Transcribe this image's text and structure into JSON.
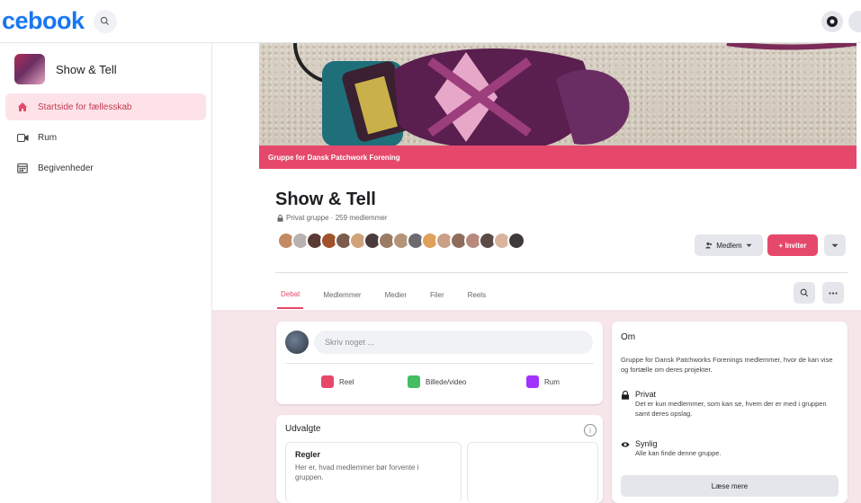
{
  "topbar": {
    "logo": "cebook"
  },
  "sidebar": {
    "group_name": "Show & Tell",
    "items": [
      {
        "label": "Startside for fællesskab",
        "icon": "home-icon"
      },
      {
        "label": "Rum",
        "icon": "video-icon"
      },
      {
        "label": "Begivenheder",
        "icon": "calendar-icon"
      }
    ]
  },
  "cover": {
    "banner_text": "Gruppe for Dansk Patchwork Forening"
  },
  "group": {
    "title": "Show & Tell",
    "meta": "Privat gruppe · 259 medlemmer",
    "member_button": "Medlem",
    "invite_button": "+ Inviter"
  },
  "tabs": [
    "Debat",
    "Medlemmer",
    "Medier",
    "Filer",
    "Reels"
  ],
  "composer": {
    "placeholder": "Skriv noget ...",
    "actions": [
      {
        "label": "Reel",
        "color": "#e6486b"
      },
      {
        "label": "Billede/video",
        "color": "#45bd62"
      },
      {
        "label": "Rum",
        "color": "#a033ff"
      }
    ]
  },
  "featured": {
    "header": "Udvalgte",
    "rule_title": "Regler",
    "rule_text": "Her er, hvad medlemmer bør forvente i gruppen."
  },
  "about": {
    "header": "Om",
    "description": "Gruppe for Dansk Patchworks Forenings medlemmer, hvor de kan vise og fortælle om deres projekter.",
    "private_title": "Privat",
    "private_text": "Det er kun medlemmer, som kan se, hvem der er med i gruppen samt deres opslag.",
    "visible_title": "Synlig",
    "visible_text": "Alle kan finde denne gruppe.",
    "more_button": "Læse mere"
  },
  "colors": {
    "accent": "#e6486b",
    "brand": "#1877f2",
    "page_bg": "#f6e6ea"
  }
}
